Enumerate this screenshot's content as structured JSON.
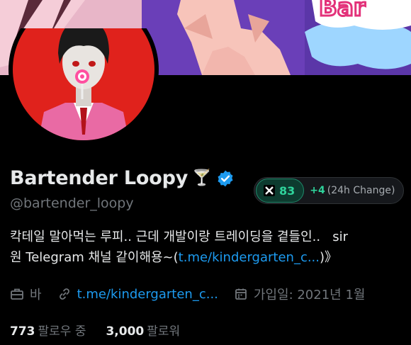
{
  "profile": {
    "display_name": "Bartender Loopy",
    "name_emoji": "🍸",
    "handle": "@bartender_loopy",
    "verified_icon": "verified-check-icon",
    "badge": {
      "icon": "x-logo-icon",
      "score": "83",
      "change": "+4",
      "change_label": "(24h Change)"
    },
    "bio_line1": "칵테일 말아먹는 루피.. 근데 개발이랑 트레이딩을 곁들인..   sir",
    "bio_line2_prefix": "원 Telegram 채널 같이해용~(",
    "bio_link": "t.me/kindergarten_c...",
    "bio_line2_suffix": ")》",
    "meta": {
      "category_icon": "briefcase-icon",
      "category": "바",
      "link_icon": "link-icon",
      "link": "t.me/kindergarten_c...",
      "joined_icon": "calendar-icon",
      "joined": "가입일: 2021년 1월"
    },
    "following_count": "773",
    "following_label": "팔로우 중",
    "followers_count": "3,000",
    "followers_label": "팔로워"
  },
  "colors": {
    "accent": "#1d9bf0",
    "score_green": "#2fd39b",
    "avatar_red": "#e0221c",
    "background": "#000000"
  }
}
